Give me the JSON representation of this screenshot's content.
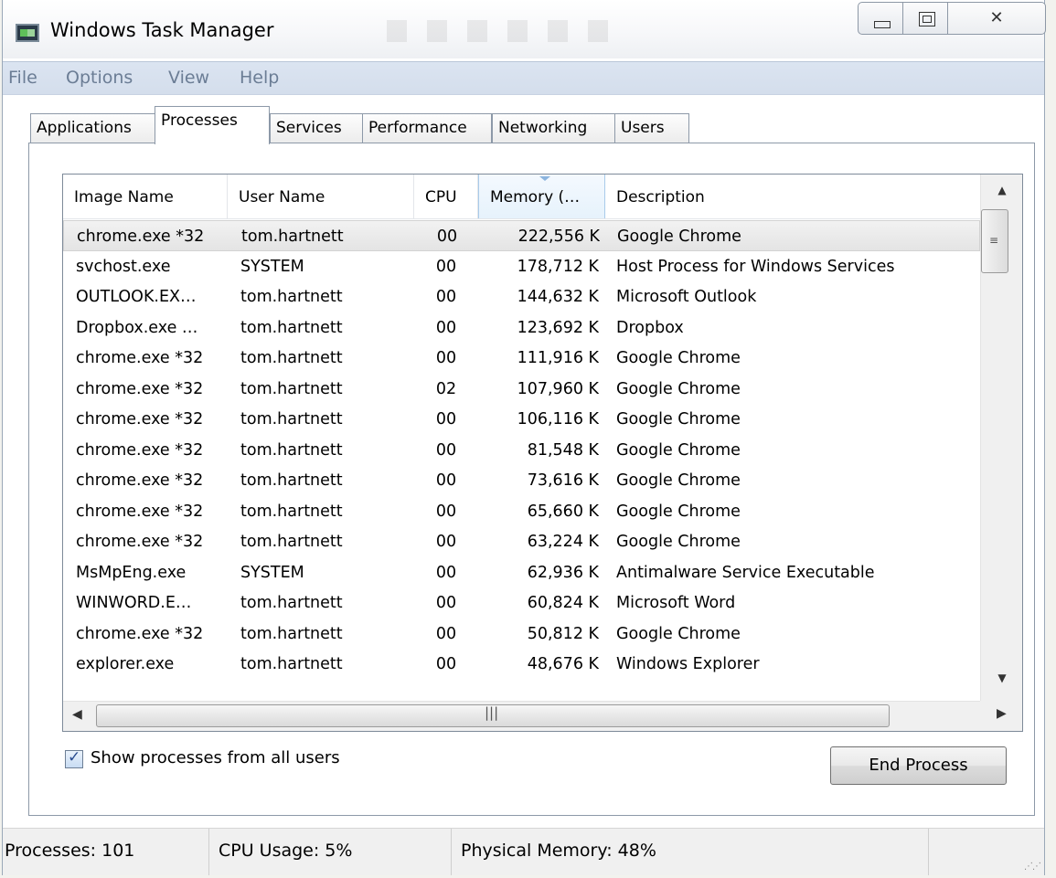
{
  "window": {
    "title": "Windows Task Manager",
    "close_glyph": "✕"
  },
  "menu": [
    "File",
    "Options",
    "View",
    "Help"
  ],
  "tabs": [
    "Applications",
    "Processes",
    "Services",
    "Performance",
    "Networking",
    "Users"
  ],
  "active_tab": "Processes",
  "columns": [
    "Image Name",
    "User Name",
    "CPU",
    "Memory (…",
    "Description"
  ],
  "sorted_column": "Memory (…",
  "rows": [
    {
      "name": "chrome.exe *32",
      "user": "tom.hartnett",
      "cpu": "00",
      "mem": "222,556 K",
      "desc": "Google Chrome",
      "selected": true
    },
    {
      "name": "svchost.exe",
      "user": "SYSTEM",
      "cpu": "00",
      "mem": "178,712 K",
      "desc": "Host Process for Windows Services"
    },
    {
      "name": "OUTLOOK.EX…",
      "user": "tom.hartnett",
      "cpu": "00",
      "mem": "144,632 K",
      "desc": "Microsoft Outlook"
    },
    {
      "name": "Dropbox.exe …",
      "user": "tom.hartnett",
      "cpu": "00",
      "mem": "123,692 K",
      "desc": "Dropbox"
    },
    {
      "name": "chrome.exe *32",
      "user": "tom.hartnett",
      "cpu": "00",
      "mem": "111,916 K",
      "desc": "Google Chrome"
    },
    {
      "name": "chrome.exe *32",
      "user": "tom.hartnett",
      "cpu": "02",
      "mem": "107,960 K",
      "desc": "Google Chrome"
    },
    {
      "name": "chrome.exe *32",
      "user": "tom.hartnett",
      "cpu": "00",
      "mem": "106,116 K",
      "desc": "Google Chrome"
    },
    {
      "name": "chrome.exe *32",
      "user": "tom.hartnett",
      "cpu": "00",
      "mem": "81,548 K",
      "desc": "Google Chrome"
    },
    {
      "name": "chrome.exe *32",
      "user": "tom.hartnett",
      "cpu": "00",
      "mem": "73,616 K",
      "desc": "Google Chrome"
    },
    {
      "name": "chrome.exe *32",
      "user": "tom.hartnett",
      "cpu": "00",
      "mem": "65,660 K",
      "desc": "Google Chrome"
    },
    {
      "name": "chrome.exe *32",
      "user": "tom.hartnett",
      "cpu": "00",
      "mem": "63,224 K",
      "desc": "Google Chrome"
    },
    {
      "name": "MsMpEng.exe",
      "user": "SYSTEM",
      "cpu": "00",
      "mem": "62,936 K",
      "desc": "Antimalware Service Executable"
    },
    {
      "name": "WINWORD.E…",
      "user": "tom.hartnett",
      "cpu": "00",
      "mem": "60,824 K",
      "desc": "Microsoft Word"
    },
    {
      "name": "chrome.exe *32",
      "user": "tom.hartnett",
      "cpu": "00",
      "mem": "50,812 K",
      "desc": "Google Chrome"
    },
    {
      "name": "explorer.exe",
      "user": "tom.hartnett",
      "cpu": "00",
      "mem": "48,676 K",
      "desc": "Windows Explorer"
    }
  ],
  "show_all_users": {
    "label": "Show processes from all users",
    "checked": true
  },
  "end_process_label": "End Process",
  "status": {
    "processes": "Processes: 101",
    "cpu_usage": "CPU Usage: 5%",
    "physical_memory": "Physical Memory: 48%"
  },
  "icons": {
    "app": "task-manager-icon",
    "minimize": "minimize-icon",
    "maximize": "restore-icon",
    "close": "close-icon",
    "sort": "sort-descending-icon",
    "grip": "resize-grip-icon"
  },
  "colors": {
    "menu_bar": "#d4deec",
    "sorted_header": "#e6f2fc",
    "selected_row": "#e4e4e4"
  }
}
